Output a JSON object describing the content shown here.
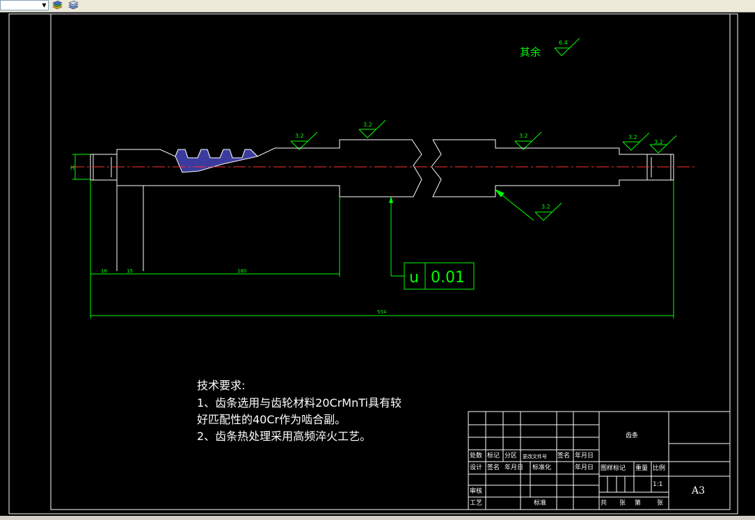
{
  "toolbar": {
    "layer_combo_value": "",
    "icons": [
      "layer-state-icon",
      "layer-stack-icon"
    ]
  },
  "drawing": {
    "colors": {
      "background": "#000000",
      "geometry": "#ffffff",
      "dimension": "#00ff00",
      "centerline": "#ff3030",
      "hatch": "#3b3b9e"
    },
    "surface_finish_general": {
      "label": "其余",
      "value": "6.4"
    },
    "roughness_marks": [
      "3.2",
      "3.2",
      "3.2",
      "3.2",
      "3.2",
      "3.2"
    ],
    "dimension_h": "H",
    "dimensions": {
      "d1": "16",
      "d2": "15",
      "d3": "180",
      "overall": "554"
    },
    "tolerance": {
      "symbol": "u",
      "value": "0.01"
    },
    "technical_requirements": {
      "title": "技术要求:",
      "line1": "1、齿条选用与齿轮材料20CrMnTi具有较",
      "line2": "好匹配性的40Cr作为啮合副。",
      "line3": "2、齿条热处理采用高频淬火工艺。"
    },
    "title_block": {
      "part_name": "齿条",
      "row_labels": {
        "chu_shu": "处数",
        "biao_ji": "标记",
        "fen_qu": "分区",
        "geng_gai": "更改文件号",
        "qian_ming": "签名",
        "nian_yue_ri": "年月日"
      },
      "design_row": {
        "she_ji": "设计",
        "qian_ming": "签名",
        "nian_yue_ri": "年月日",
        "biao_zhun_hua": "标准化",
        "nian_yue_ri2": "年月日"
      },
      "review": "审核",
      "process": "工艺",
      "standard": "标准",
      "stage_mark": "图样标记",
      "weight": "重量",
      "scale_label": "比例",
      "scale_value": "1:1",
      "sheet_total": "共",
      "sheet_unit1": "张",
      "sheet_no": "第",
      "sheet_unit2": "张",
      "paper_size": "A3"
    }
  }
}
